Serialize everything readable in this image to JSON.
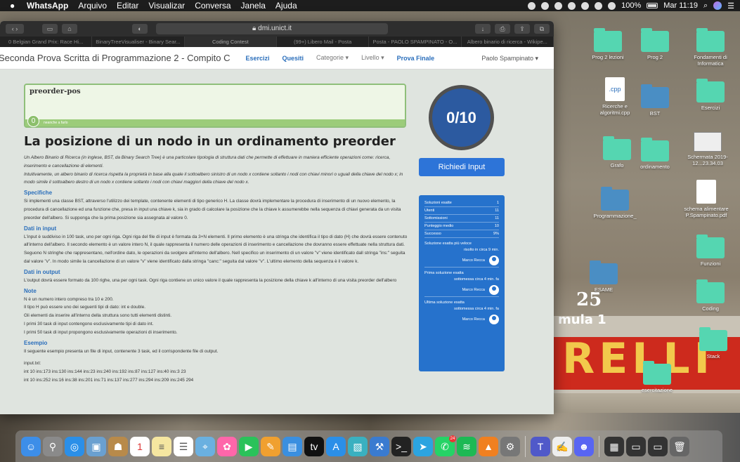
{
  "menubar": {
    "apple": "",
    "app": "WhatsApp",
    "items": [
      "Arquivo",
      "Editar",
      "Visualizar",
      "Conversa",
      "Janela",
      "Ajuda"
    ],
    "battery": "100%",
    "clock": "Mar 11:19"
  },
  "browser": {
    "url": "dmi.unict.it",
    "tabs": [
      "0 Belgian Grand Prix: Race Hi...",
      "BinaryTreeVisualiser - Binary Sear...",
      "Coding Contest",
      "(99+) Libero Mail - Posta",
      "Posta - PAOLO SPAMPINATO - O...",
      "Albero binario di ricerca - Wikipe..."
    ],
    "active_tab": 2
  },
  "navbar": {
    "brand": "Seconda Prova Scritta di Programmazione 2 - Compito C",
    "links": [
      "Esercizi",
      "Quesiti"
    ],
    "dropdowns": [
      "Categorie ▾",
      "Livello ▾"
    ],
    "final": "Prova Finale",
    "user": "Paolo Spampinato ▾"
  },
  "problem": {
    "name": "preorder-pos",
    "difficulty_badge": "0",
    "difficulty_text": "neanche a farlo"
  },
  "main": {
    "title": "La posizione di un nodo in un ordinamento preorder",
    "intro": "Un Albero Binario di Ricerca (in inglese, BST, da Binary Search Tree) è una particolare tipologia di struttura dati che permette di effettuare in maniera efficiente operazioni come: ricerca, inserimento e cancellazione di elementi.",
    "intro2": "Intuitivamente, un albero binario di ricerca rispetta la proprietà in base alla quale il sottoalbero sinistro di un nodo x contiene soltanto i nodi con chiavi minori o uguali della chiave del nodo x; in modo simile il sottoalbero destro di un nodo x contiene soltanto i nodi con chiavi maggiori della chiave del nodo x.",
    "h_spec": "Specifiche",
    "spec": "Si implementi una classe BST, attraverso l'utilizzo dei template, contenente elementi di tipo generico H. La classe dovrà implementare la procedura di inserimento di un nuovo elemento, la procedura di cancellazione ed una funzione che, presa in input una chiave k, sia in grado di calcolare la posizione che la chiave k assumerebbe nella sequenza di chiavi generata da un visita preorder dell'albero. Si supponga che la prima posizione sia assegnata al valore 0.",
    "h_input": "Dati in input",
    "input": "L'input è suddiviso in 100 task, uno per ogni riga. Ogni riga del file di input è formata da 3+N elementi. Il primo elemento è una stringa che identifica il tipo di dato (H) che dovrà essere contenuto all'interno dell'albero. Il secondo elemento è un valore intero N, il quale rappresenta il numero delle operazioni di inserimento e cancellazione che dovranno essere effettuate nella struttura dati. Seguono N stringhe che rappresentano, nell'ordine dato, le operazioni da svolgere all'interno dell'albero. Nell specifico un inserimento di un valore \"v\" viene identificato dall stringa \"ins:\" seguita dal valore \"v\". In modo simile la cancellazione di un valore \"v\" viene identificato dalla stringa \"canc:\" seguita dal valore \"v\". L'ultimo elemento della sequenza è il valore k.",
    "h_output": "Dati in output",
    "output": "L'output dovrà essere formato da 100 righe, una per ogni task. Ogni riga contiene un unico valore il quale rappresenta la posizione della chiave k all'interno di una visita preorder dell'albero",
    "h_note": "Note",
    "notes": [
      "N è un numero intero compreso tra 10 e 200.",
      "Il tipo H può essere uno dei seguenti tipi di dato: int e double.",
      "Gli elementi da inserire all'interno della struttura sono tutti elementi distinti.",
      "I primi 30 task di input contengono esclusivamente tipi di dato int.",
      "I primi 50 task di input propongono esclusivamente operazioni di inserimento."
    ],
    "h_example": "Esempio",
    "example": "Il seguente esempio presenta un file di input, contenente 3 task, ed il corrispondente file di output.",
    "input_label": "input.txt:",
    "input_lines": [
      "int 10 ins:173 ins:130 ins:144 ins:23 ins:240 ins:192 ins:87 ins:127 ins:40 ins:3 23",
      "int 10 ins:252 ins:16 ins:38 ins:201 ins:71 ins:137 ins:277 ins:294 ins:209 ins:245 294"
    ]
  },
  "score": {
    "value": "0/10"
  },
  "request_button": "Richiedi Input",
  "stats": {
    "rows": [
      {
        "label": "Soluzioni esatte",
        "value": "1"
      },
      {
        "label": "Utenti",
        "value": "11"
      },
      {
        "label": "Sottomissioni",
        "value": "11"
      },
      {
        "label": "Punteggio medio",
        "value": "10"
      },
      {
        "label": "Successo",
        "value": "9%"
      }
    ],
    "fastest_label": "Soluzione esatta più veloce",
    "fastest_sub": "risolto in circa 9 min.",
    "fastest_user": "Marco Recca",
    "first_label": "Prima soluzione esatta",
    "first_sub": "sottomessa circa 4 min. fa",
    "first_user": "Marco Recca",
    "last_label": "Ultima soluzione esatta",
    "last_sub": "sottomessa circa 4 min. fa",
    "last_user": "Marco Recca"
  },
  "desktop": {
    "icons": [
      "Prog 2 lezioni",
      "Prog 2",
      "Fondamenti di Informatica",
      "Ricerche e algoritmi.cpp",
      "BST",
      "Esercizi",
      "Grafo",
      "ordinamento",
      "Schermata 2019-12...23.34.03",
      "Programmazione_",
      "schema alimentare P.Spampinato.pdf",
      "Funzioni",
      "Coding",
      "Stack",
      "esercitazione",
      "ESAME"
    ],
    "cpp_label": ".cpp"
  },
  "background": {
    "r1": "RELLI",
    "f1": "mula 1",
    "n25": "25"
  },
  "colors": {
    "accent": "#2a6ebb",
    "score_bg": "#2c5aa0",
    "stats_bg": "#2672cc",
    "folder": "#55d6b1"
  }
}
